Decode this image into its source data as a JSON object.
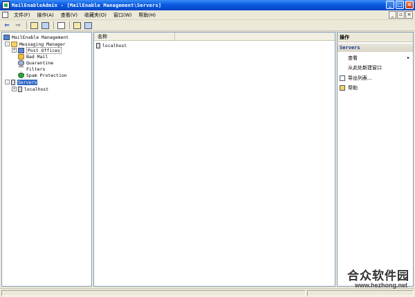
{
  "window": {
    "title": "MailEnableAdmin - [MailEnable Management\\Servers]",
    "controls": {
      "minimize": "_",
      "maximize": "□",
      "close": "×"
    }
  },
  "menubar": {
    "items": [
      "文件(F)",
      "操作(A)",
      "查看(V)",
      "收藏夹(O)",
      "窗口(W)",
      "帮助(H)"
    ],
    "mdi_controls": [
      "_",
      "▫",
      "×"
    ]
  },
  "toolbar": {
    "back": "⇐",
    "forward": "⇒",
    "buttons": [
      "up-folder-icon",
      "show-tree-icon",
      "export-list-icon",
      "properties-icon",
      "console-window-icon"
    ]
  },
  "tree": {
    "root": "MailEnable Management",
    "messaging_manager": "Messaging Manager",
    "post_offices": "Post Offices",
    "bad_mail": "Bad Mail",
    "quarantine": "Quarantine",
    "filters": "Filters",
    "spam_protection": "Spam Protection",
    "servers": "Servers",
    "localhost": "localhost",
    "expand_plus": "+",
    "collapse_minus": "-"
  },
  "list": {
    "column_name": "名称",
    "rows": [
      "localhost"
    ]
  },
  "actions": {
    "header": "操作",
    "section": "Servers",
    "items": {
      "view": "查看",
      "new_window": "从此处新建窗口",
      "export_list": "导出列表...",
      "help": "帮助"
    },
    "submenu_arrow": "▸"
  },
  "watermark": {
    "text": "合众软件园",
    "url": "www.hezhong.net"
  }
}
